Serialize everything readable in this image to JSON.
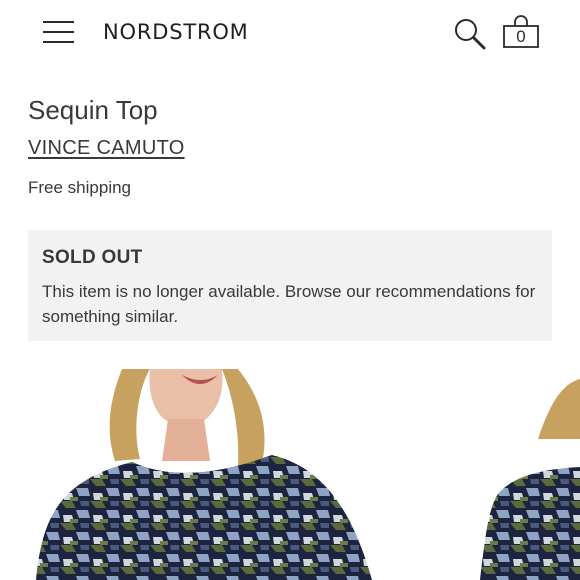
{
  "header": {
    "logo": "NORDSTROM",
    "menu_icon": "hamburger-menu-icon",
    "search_icon": "search-icon",
    "bag_icon": "shopping-bag-icon",
    "bag_count": "0"
  },
  "product": {
    "title": "Sequin Top",
    "brand": "VINCE CAMUTO",
    "shipping": "Free shipping"
  },
  "availability": {
    "heading": "SOLD OUT",
    "message": "This item is no longer available. Browse our recommendations for something similar."
  },
  "colors": {
    "text": "#393939",
    "notice_background": "#f2f2f2",
    "sequin_navy": "#1d2440",
    "sequin_olive": "#5a6a3a"
  }
}
